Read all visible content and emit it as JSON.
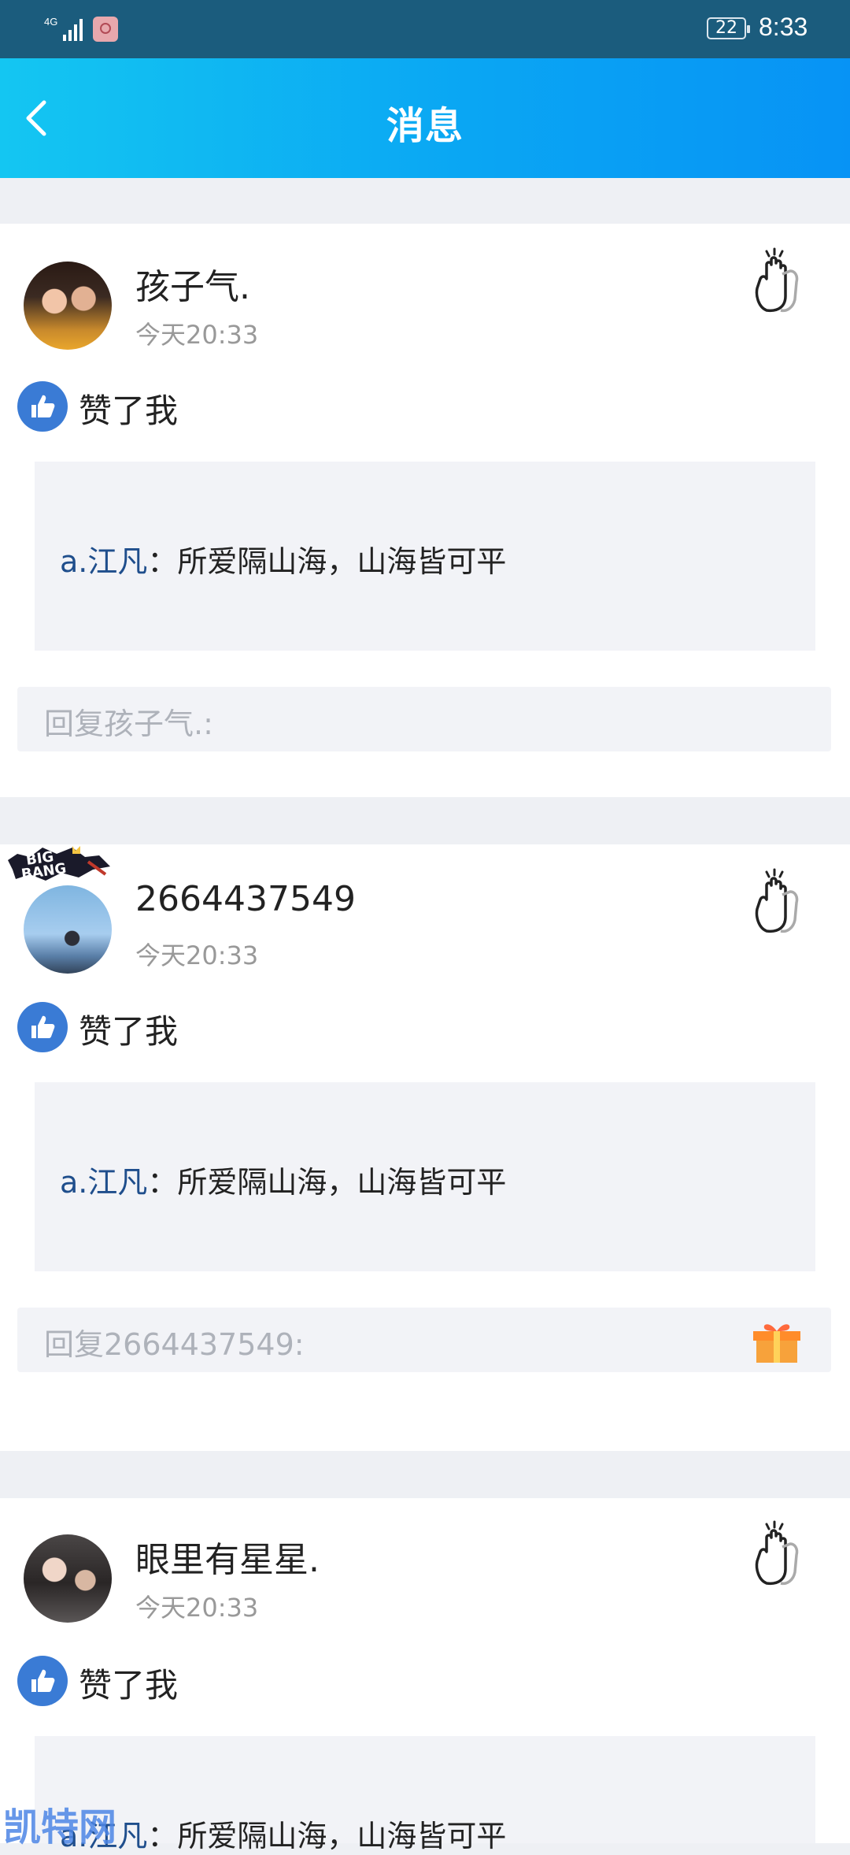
{
  "status_bar": {
    "network": "4G",
    "battery": "22",
    "time": "8:33"
  },
  "header": {
    "title": "消息"
  },
  "notifications": [
    {
      "name": "孩子气.",
      "time": "今天20:33",
      "action": "赞了我",
      "quote_user": "a.江凡",
      "quote_text": "：所爱隔山海，山海皆可平",
      "reply_placeholder": "回复孩子气.:"
    },
    {
      "name": "2664437549",
      "time": "今天20:33",
      "action": "赞了我",
      "quote_user": "a.江凡",
      "quote_text": "：所爱隔山海，山海皆可平",
      "reply_placeholder": "回复2664437549:"
    },
    {
      "name": "眼里有星星.",
      "time": "今天20:33",
      "action": "赞了我",
      "quote_user": "a.江凡",
      "quote_text": "：所爱隔山海，山海皆可平"
    }
  ],
  "watermark": "凯特网",
  "icons": [
    "back-icon",
    "wave-hand-icon",
    "thumbs-up-icon",
    "gift-icon"
  ]
}
